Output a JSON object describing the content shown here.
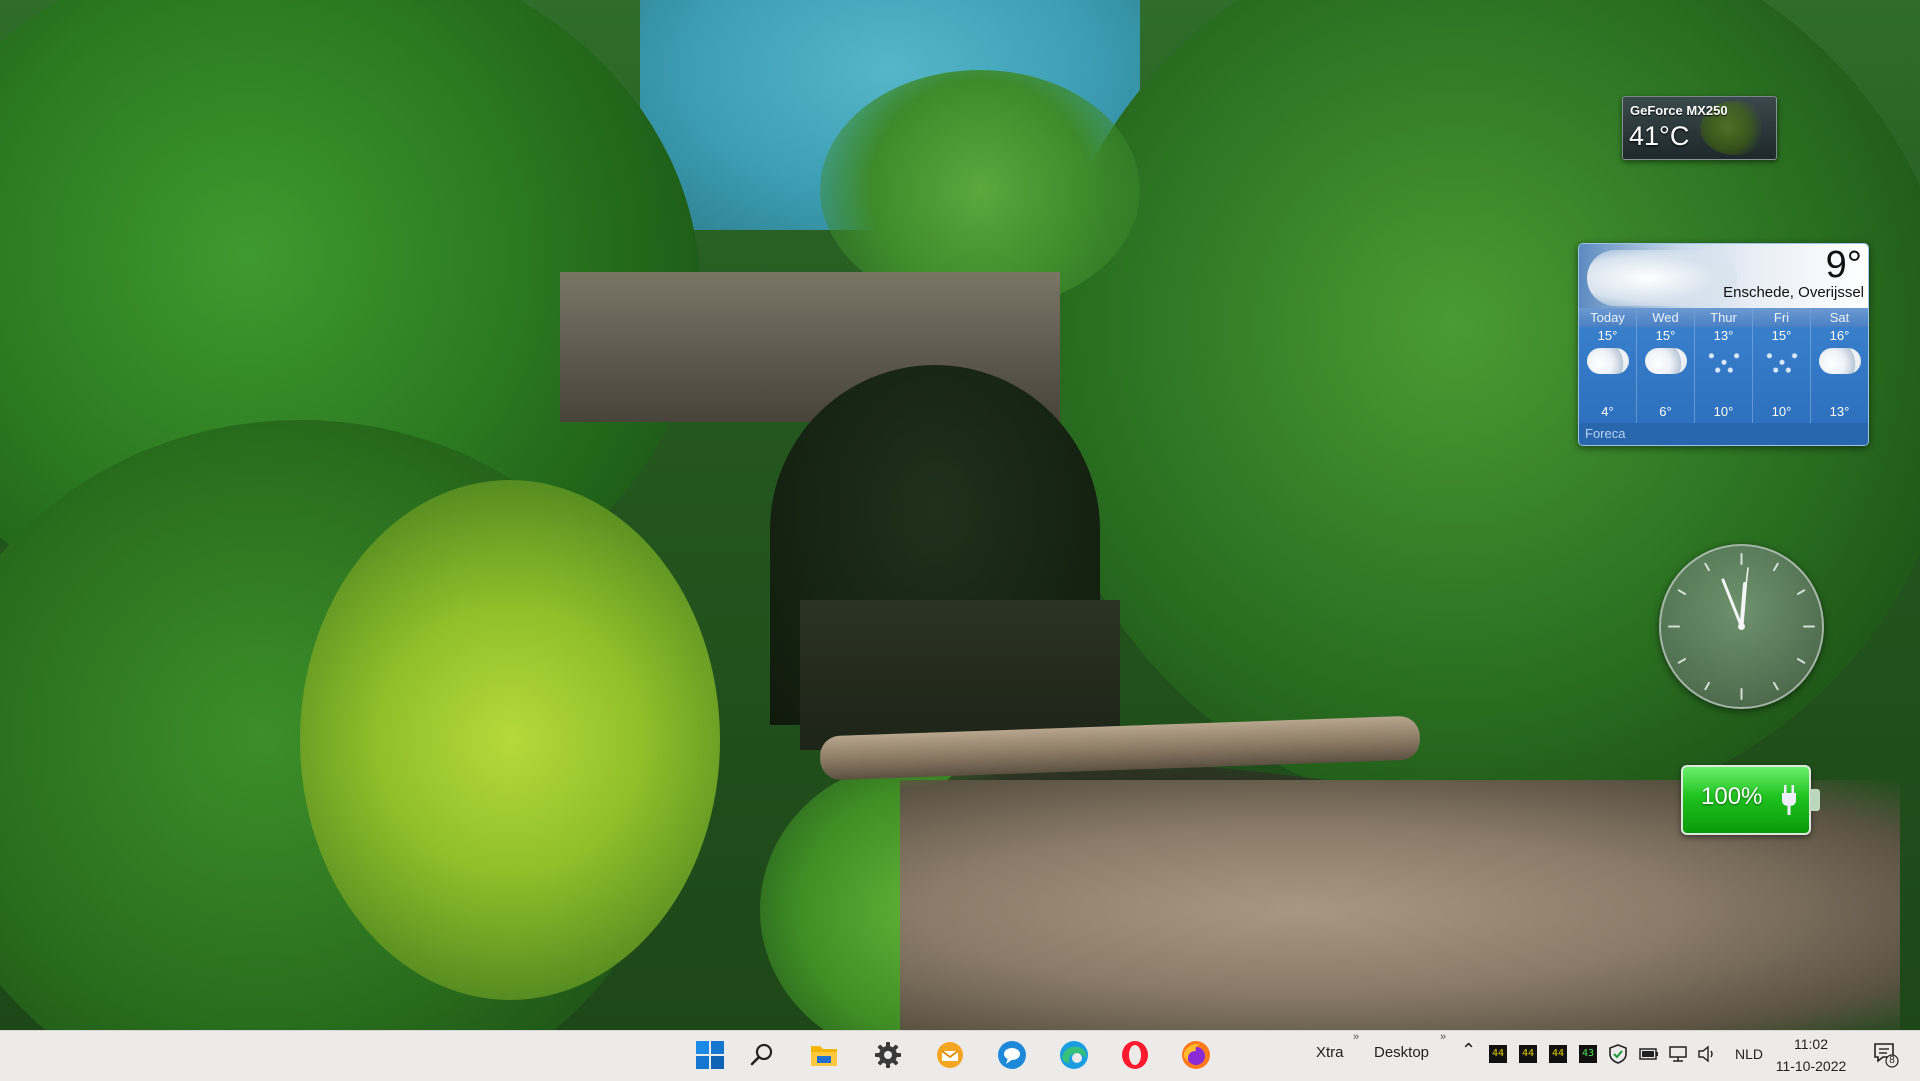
{
  "gpu_gadget": {
    "name": "GeForce MX250",
    "temperature": "41°C"
  },
  "weather_gadget": {
    "current_temp": "9°",
    "location": "Enschede, Overijssel",
    "source": "Foreca",
    "days": [
      {
        "name": "Today",
        "high": "15°",
        "low": "4°",
        "icon": "cloud-icon"
      },
      {
        "name": "Wed",
        "high": "15°",
        "low": "6°",
        "icon": "cloud-icon"
      },
      {
        "name": "Thur",
        "high": "13°",
        "low": "10°",
        "icon": "drizzle-icon"
      },
      {
        "name": "Fri",
        "high": "15°",
        "low": "10°",
        "icon": "drizzle-icon"
      },
      {
        "name": "Sat",
        "high": "16°",
        "low": "13°",
        "icon": "cloud-icon"
      }
    ]
  },
  "clock_gadget": {
    "time": "11:02"
  },
  "battery_gadget": {
    "percent": "100%",
    "level": 1.0,
    "charging_icon": "plug-icon",
    "color": "#1fc21f"
  },
  "taskbar": {
    "pinned": [
      {
        "name": "start-button",
        "icon": "windows-icon"
      },
      {
        "name": "search-button",
        "icon": "search-icon"
      },
      {
        "name": "file-explorer-button",
        "icon": "folder-icon"
      },
      {
        "name": "settings-button",
        "icon": "gear-icon"
      },
      {
        "name": "mail-app-button",
        "icon": "mail-icon"
      },
      {
        "name": "messenger-app-button",
        "icon": "chat-icon"
      },
      {
        "name": "edge-browser-button",
        "icon": "edge-icon"
      },
      {
        "name": "opera-browser-button",
        "icon": "opera-icon"
      },
      {
        "name": "firefox-browser-button",
        "icon": "firefox-icon"
      }
    ],
    "toolbars": [
      "Xtra",
      "Desktop"
    ],
    "tray_numbers": [
      "44",
      "44",
      "44",
      "43"
    ],
    "language": "NLD",
    "time": "11:02",
    "date": "11-10-2022",
    "notification_count": "8"
  },
  "colors": {
    "taskbar_bg": "#ecebea",
    "weather_blue": "#2e74c2",
    "windows_accent": "#0f78d4"
  }
}
